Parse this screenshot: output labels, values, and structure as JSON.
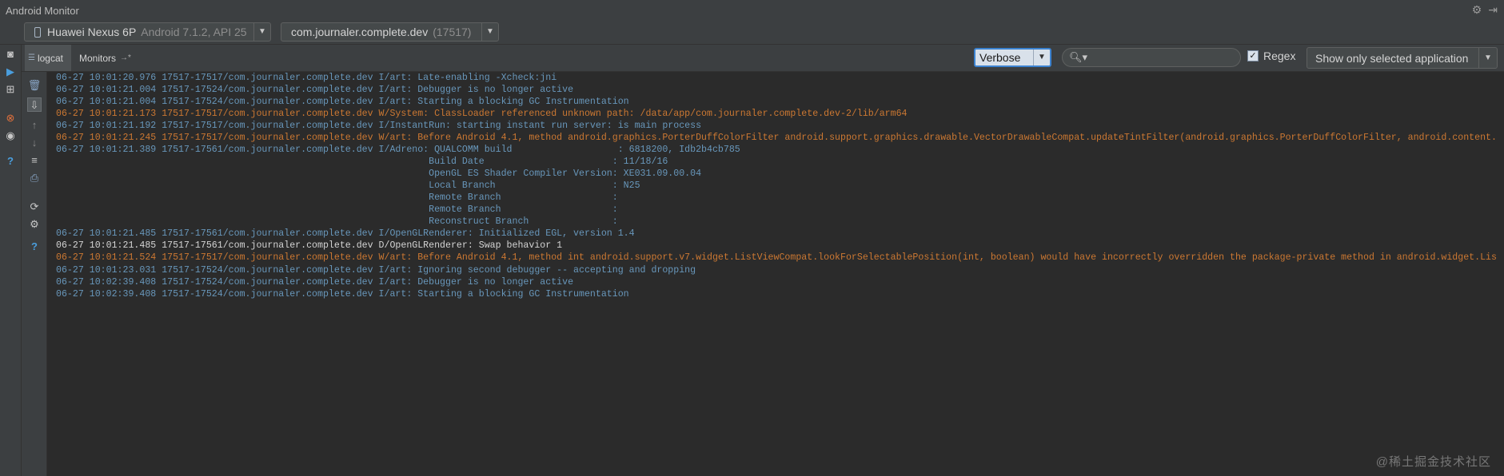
{
  "window": {
    "title": "Android Monitor"
  },
  "titlebar": {
    "gear_glyph": "⚙",
    "hide_glyph": "⇥"
  },
  "device_selector": {
    "device": "Huawei Nexus 6P",
    "device_detail": "Android 7.1.2, API 25"
  },
  "process_selector": {
    "process": "com.journaler.complete.dev",
    "pid": "(17517)"
  },
  "tabs": [
    {
      "label": "logcat",
      "active": true
    },
    {
      "label": "Monitors",
      "active": false
    }
  ],
  "log_level": {
    "selected": "Verbose"
  },
  "search": {
    "value": "",
    "placeholder": ""
  },
  "regex": {
    "label": "Regex",
    "checked": true
  },
  "app_filter": {
    "selected": "Show only selected application"
  },
  "left_icons": [
    "camera-icon",
    "record-icon",
    "layout-inspector-icon",
    "stop-icon",
    "gc-icon",
    "help-icon"
  ],
  "action_icons": [
    "clear-log-icon",
    "scroll-to-end-icon",
    "up-icon",
    "down-icon",
    "soft-wrap-icon",
    "print-icon",
    "restart-icon",
    "settings-icon",
    "help-icon"
  ],
  "colors": {
    "info": "#6897bb",
    "warn": "#cc7832",
    "debug": "#d4d4d4",
    "background": "#2b2b2b"
  },
  "log_lines": [
    {
      "level": "I",
      "text": "06-27 10:01:20.976 17517-17517/com.journaler.complete.dev I/art: Late-enabling -Xcheck:jni"
    },
    {
      "level": "I",
      "text": "06-27 10:01:21.004 17517-17524/com.journaler.complete.dev I/art: Debugger is no longer active"
    },
    {
      "level": "I",
      "text": "06-27 10:01:21.004 17517-17524/com.journaler.complete.dev I/art: Starting a blocking GC Instrumentation"
    },
    {
      "level": "W",
      "text": "06-27 10:01:21.173 17517-17517/com.journaler.complete.dev W/System: ClassLoader referenced unknown path: /data/app/com.journaler.complete.dev-2/lib/arm64"
    },
    {
      "level": "I",
      "text": "06-27 10:01:21.192 17517-17517/com.journaler.complete.dev I/InstantRun: starting instant run server: is main process"
    },
    {
      "level": "W",
      "text": "06-27 10:01:21.245 17517-17517/com.journaler.complete.dev W/art: Before Android 4.1, method android.graphics.PorterDuffColorFilter android.support.graphics.drawable.VectorDrawableCompat.updateTintFilter(android.graphics.PorterDuffColorFilter, android.content."
    },
    {
      "level": "I",
      "text": "06-27 10:01:21.389 17517-17561/com.journaler.complete.dev I/Adreno: QUALCOMM build                   : 6818200, Idb2b4cb785"
    },
    {
      "level": "I",
      "text": "                                                                   Build Date                       : 11/18/16"
    },
    {
      "level": "I",
      "text": "                                                                   OpenGL ES Shader Compiler Version: XE031.09.00.04"
    },
    {
      "level": "I",
      "text": "                                                                   Local Branch                     : N25"
    },
    {
      "level": "I",
      "text": "                                                                   Remote Branch                    :"
    },
    {
      "level": "I",
      "text": "                                                                   Remote Branch                    :"
    },
    {
      "level": "I",
      "text": "                                                                   Reconstruct Branch               :"
    },
    {
      "level": "I",
      "text": "06-27 10:01:21.485 17517-17561/com.journaler.complete.dev I/OpenGLRenderer: Initialized EGL, version 1.4"
    },
    {
      "level": "D",
      "text": "06-27 10:01:21.485 17517-17561/com.journaler.complete.dev D/OpenGLRenderer: Swap behavior 1"
    },
    {
      "level": "W",
      "text": "06-27 10:01:21.524 17517-17517/com.journaler.complete.dev W/art: Before Android 4.1, method int android.support.v7.widget.ListViewCompat.lookForSelectablePosition(int, boolean) would have incorrectly overridden the package-private method in android.widget.Lis"
    },
    {
      "level": "I",
      "text": "06-27 10:01:23.031 17517-17524/com.journaler.complete.dev I/art: Ignoring second debugger -- accepting and dropping"
    },
    {
      "level": "I",
      "text": "06-27 10:02:39.408 17517-17524/com.journaler.complete.dev I/art: Debugger is no longer active"
    },
    {
      "level": "I",
      "text": "06-27 10:02:39.408 17517-17524/com.journaler.complete.dev I/art: Starting a blocking GC Instrumentation"
    }
  ],
  "watermark": "@稀土掘金技术社区"
}
